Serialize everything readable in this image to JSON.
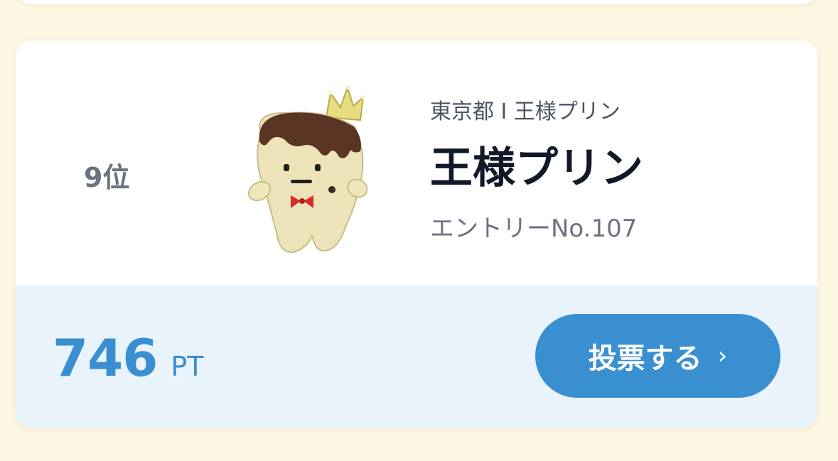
{
  "card": {
    "rank": "9位",
    "subtitle": "東京都 I 王様プリン",
    "name": "王様プリン",
    "entry": "エントリーNo.107",
    "points_value": "746",
    "points_unit": "PT",
    "vote_label": "投票する",
    "vote_chevron": "›"
  },
  "colors": {
    "accent": "#3a8fd1",
    "page_background": "#fdf6e3",
    "card_bottom_background": "#e9f3fb"
  },
  "icons": {
    "vote_chevron": "chevron-right-icon"
  }
}
